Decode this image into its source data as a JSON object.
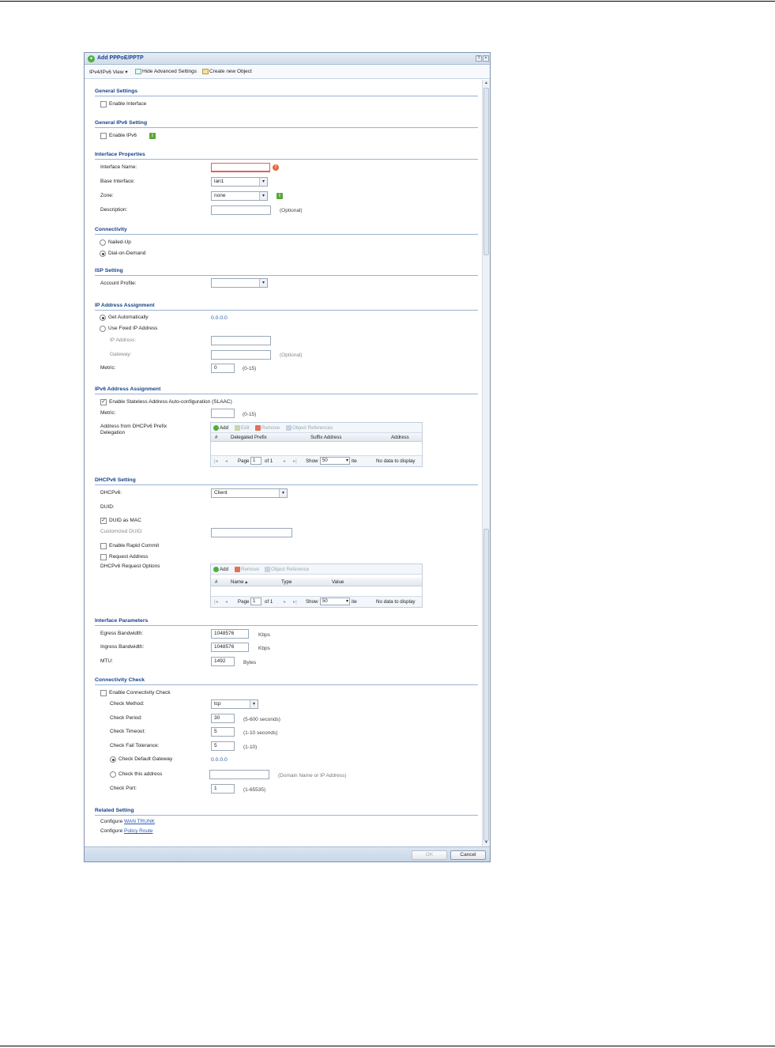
{
  "dialog": {
    "title": "Add PPPoE/PPTP",
    "help_glyph": "?",
    "close_glyph": "×"
  },
  "toolbar": {
    "view_label": "IPv4/IPv6 View",
    "view_chevron": "▾",
    "advanced_label": "Hide Advanced Settings",
    "create_label": "Create new Object"
  },
  "general": {
    "title": "General Settings",
    "enable_interface": "Enable Interface"
  },
  "general_ipv6": {
    "title": "General IPv6 Setting",
    "enable_ipv6": "Enable IPv6"
  },
  "interface": {
    "title": "Interface Properties",
    "name_label": "Interface Name:",
    "name_value": "",
    "base_label": "Base Interface:",
    "base_value": "lan1",
    "zone_label": "Zone:",
    "zone_value": "none",
    "desc_label": "Description:",
    "desc_value": "",
    "desc_hint": "(Optional)"
  },
  "connectivity": {
    "title": "Connectivity",
    "nailed_up": "Nailed-Up",
    "dial_on_demand": "Dial-on-Demand"
  },
  "isp": {
    "title": "ISP Setting",
    "account_label": "Account Profile:",
    "account_value": ""
  },
  "ip_assign": {
    "title": "IP Address Assignment",
    "get_auto": "Get Automatically",
    "auto_value": "0.0.0.0",
    "use_fixed": "Use Fixed IP Address",
    "ip_label": "IP Address:",
    "gateway_label": "Gateway:",
    "gateway_hint": "(Optional)",
    "metric_label": "Metric:",
    "metric_value": "0",
    "metric_hint": "(0-15)"
  },
  "ipv6_assign": {
    "title": "IPv6 Address Assignment",
    "slaac": "Enable Stateless Address Auto-configuration (SLAAC)",
    "metric_label": "Metric:",
    "metric_value": "",
    "metric_hint": "(0-15)",
    "dhcp_prefix_label_1": "Address from DHCPv6 Prefix",
    "dhcp_prefix_label_2": "Delegation",
    "grid": {
      "add": "Add",
      "edit": "Edit",
      "remove": "Remove",
      "object_ref": "Object References",
      "columns": [
        "#",
        "Delegated Prefix",
        "Suffix Address",
        "Address"
      ],
      "page_label": "Page",
      "page_value": "1",
      "of_label": "of 1",
      "show_label": "Show",
      "show_value": "50",
      "items_label": "items",
      "empty": "No data to display"
    }
  },
  "dhcpv6": {
    "title": "DHCPv6 Setting",
    "dhcpv6_label": "DHCPv6:",
    "dhcpv6_value": "Client",
    "duid_label": "DUID:",
    "duid_as_mac": "DUID as MAC",
    "customized_duid": "Customized DUID:",
    "rapid_commit": "Enable Rapid Commit",
    "request_address": "Request Address",
    "request_options": "DHCPv6 Request Options",
    "grid": {
      "add": "Add",
      "remove": "Remove",
      "object_ref": "Object Reference",
      "columns": [
        "#",
        "Name ▴",
        "Type",
        "Value"
      ],
      "page_label": "Page",
      "page_value": "1",
      "of_label": "of 1",
      "show_label": "Show",
      "show_value": "50",
      "items_label": "items",
      "empty": "No data to display"
    }
  },
  "params": {
    "title": "Interface Parameters",
    "egress_label": "Egress Bandwidth:",
    "egress_value": "1048576",
    "egress_unit": "Kbps",
    "ingress_label": "Ingress Bandwidth:",
    "ingress_value": "1048576",
    "ingress_unit": "Kbps",
    "mtu_label": "MTU:",
    "mtu_value": "1492",
    "mtu_unit": "Bytes"
  },
  "check": {
    "title": "Connectivity Check",
    "enable": "Enable Connectivity Check",
    "method_label": "Check Method:",
    "method_value": "tcp",
    "period_label": "Check Period:",
    "period_value": "30",
    "period_hint": "(5-600 seconds)",
    "timeout_label": "Check Timeout:",
    "timeout_value": "5",
    "timeout_hint": "(1-10 seconds)",
    "fail_label": "Check Fail Tolerance:",
    "fail_value": "5",
    "fail_hint": "(1-10)",
    "default_gw": "Check Default Gateway",
    "default_gw_value": "0.0.0.0",
    "this_address": "Check this address",
    "this_address_hint": "(Domain Name or IP Address)",
    "port_label": "Check Port:",
    "port_value": "1",
    "port_hint": "(1-65535)"
  },
  "related": {
    "title": "Related Setting",
    "configure": "Configure",
    "wan_trunk": "WAN TRUNK",
    "policy_route": "Policy Route"
  },
  "footer": {
    "ok": "OK",
    "cancel": "Cancel"
  }
}
